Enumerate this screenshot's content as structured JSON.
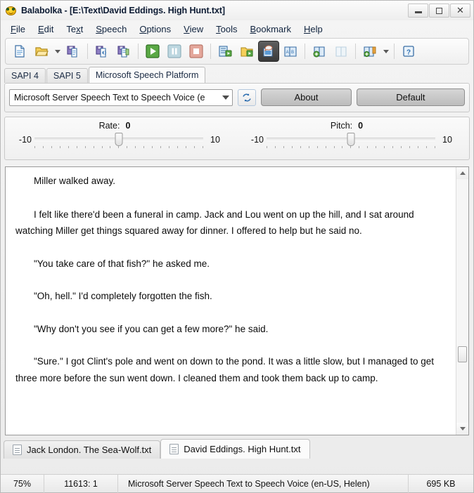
{
  "window": {
    "title": "Balabolka - [E:\\Text\\David Eddings. High Hunt.txt]",
    "app_icon": "balabolka-face-icon",
    "controls": {
      "minimize": "minimize-icon",
      "maximize": "maximize-icon",
      "close": "close-icon"
    }
  },
  "menubar": {
    "items": [
      {
        "label": "File",
        "accel": "F"
      },
      {
        "label": "Edit",
        "accel": "E"
      },
      {
        "label": "Text",
        "accel": "x"
      },
      {
        "label": "Speech",
        "accel": "S"
      },
      {
        "label": "Options",
        "accel": "O"
      },
      {
        "label": "View",
        "accel": "V"
      },
      {
        "label": "Tools",
        "accel": "T"
      },
      {
        "label": "Bookmark",
        "accel": "B"
      },
      {
        "label": "Help",
        "accel": "H"
      }
    ]
  },
  "toolbar": {
    "buttons": [
      {
        "name": "new-document-icon",
        "pressed": false
      },
      {
        "name": "open-file-icon",
        "pressed": false
      },
      {
        "name": "open-file-dropdown-arrow-icon",
        "type": "arrow"
      },
      {
        "name": "save-file-icon",
        "pressed": false
      },
      {
        "separator": true
      },
      {
        "name": "save-audio-file-icon",
        "pressed": false
      },
      {
        "name": "save-split-audio-icon",
        "pressed": false
      },
      {
        "separator": true
      },
      {
        "name": "play-icon",
        "pressed": false
      },
      {
        "name": "pause-icon",
        "pressed": false
      },
      {
        "name": "stop-icon",
        "pressed": false
      },
      {
        "separator": true
      },
      {
        "name": "batch-play-icon",
        "pressed": false
      },
      {
        "name": "batch-folder-icon",
        "pressed": false
      },
      {
        "name": "speech-settings-icon",
        "pressed": true
      },
      {
        "name": "dictionary-icon",
        "pressed": false
      },
      {
        "separator": true
      },
      {
        "name": "add-bookmark-icon",
        "pressed": false
      },
      {
        "name": "remove-bookmark-icon",
        "pressed": false
      },
      {
        "separator": true
      },
      {
        "name": "bookmark-list-icon",
        "pressed": false
      },
      {
        "name": "bookmark-dropdown-arrow-icon",
        "type": "arrow"
      },
      {
        "separator": true
      },
      {
        "name": "help-icon",
        "pressed": false
      }
    ]
  },
  "engine_tabs": {
    "items": [
      {
        "label": "SAPI 4",
        "active": false
      },
      {
        "label": "SAPI 5",
        "active": false
      },
      {
        "label": "Microsoft Speech Platform",
        "active": true
      }
    ]
  },
  "voice_panel": {
    "voice_combo_value": "Microsoft Server Speech Text to Speech Voice (e",
    "refresh_icon": "refresh-voices-icon",
    "about_label": "About",
    "default_label": "Default"
  },
  "sliders": {
    "rate": {
      "label": "Rate:",
      "value": "0",
      "min_label": "-10",
      "max_label": "10",
      "min": -10,
      "max": 10,
      "value_num": 0
    },
    "pitch": {
      "label": "Pitch:",
      "value": "0",
      "min_label": "-10",
      "max_label": "10",
      "min": -10,
      "max": 10,
      "value_num": 0
    }
  },
  "editor": {
    "paragraphs": [
      "Miller walked away.",
      "I felt like there'd been a funeral in camp. Jack and Lou went on up the hill, and I sat around watching Miller get things squared away for dinner. I offered to help but he said no.",
      "\"You take care of that fish?\" he asked me.",
      "\"Oh, hell.\" I'd completely forgotten the fish.",
      "\"Why don't you see if you can get a few more?\" he said.",
      "\"Sure.\" I got Clint's pole and went on down to the pond. It was a little slow, but I managed to get three more before the sun went down. I cleaned them and took them back up to camp."
    ],
    "scrollbar": {
      "up_arrow": "scroll-up-icon",
      "down_arrow": "scroll-down-icon",
      "thumb_position_percent": 70
    }
  },
  "document_tabs": {
    "items": [
      {
        "label": "Jack London. The Sea-Wolf.txt",
        "active": false
      },
      {
        "label": "David Eddings. High Hunt.txt",
        "active": true
      }
    ]
  },
  "statusbar": {
    "zoom": "75%",
    "position": "11613:  1",
    "voice": "Microsoft Server Speech Text to Speech Voice (en-US, Helen)",
    "file_size": "695 KB"
  },
  "colors": {
    "chrome": "#f0f0f0",
    "title_text": "#0c1b33",
    "editor_bg": "#ffffff",
    "pressed_button": "#3a3a3a"
  }
}
